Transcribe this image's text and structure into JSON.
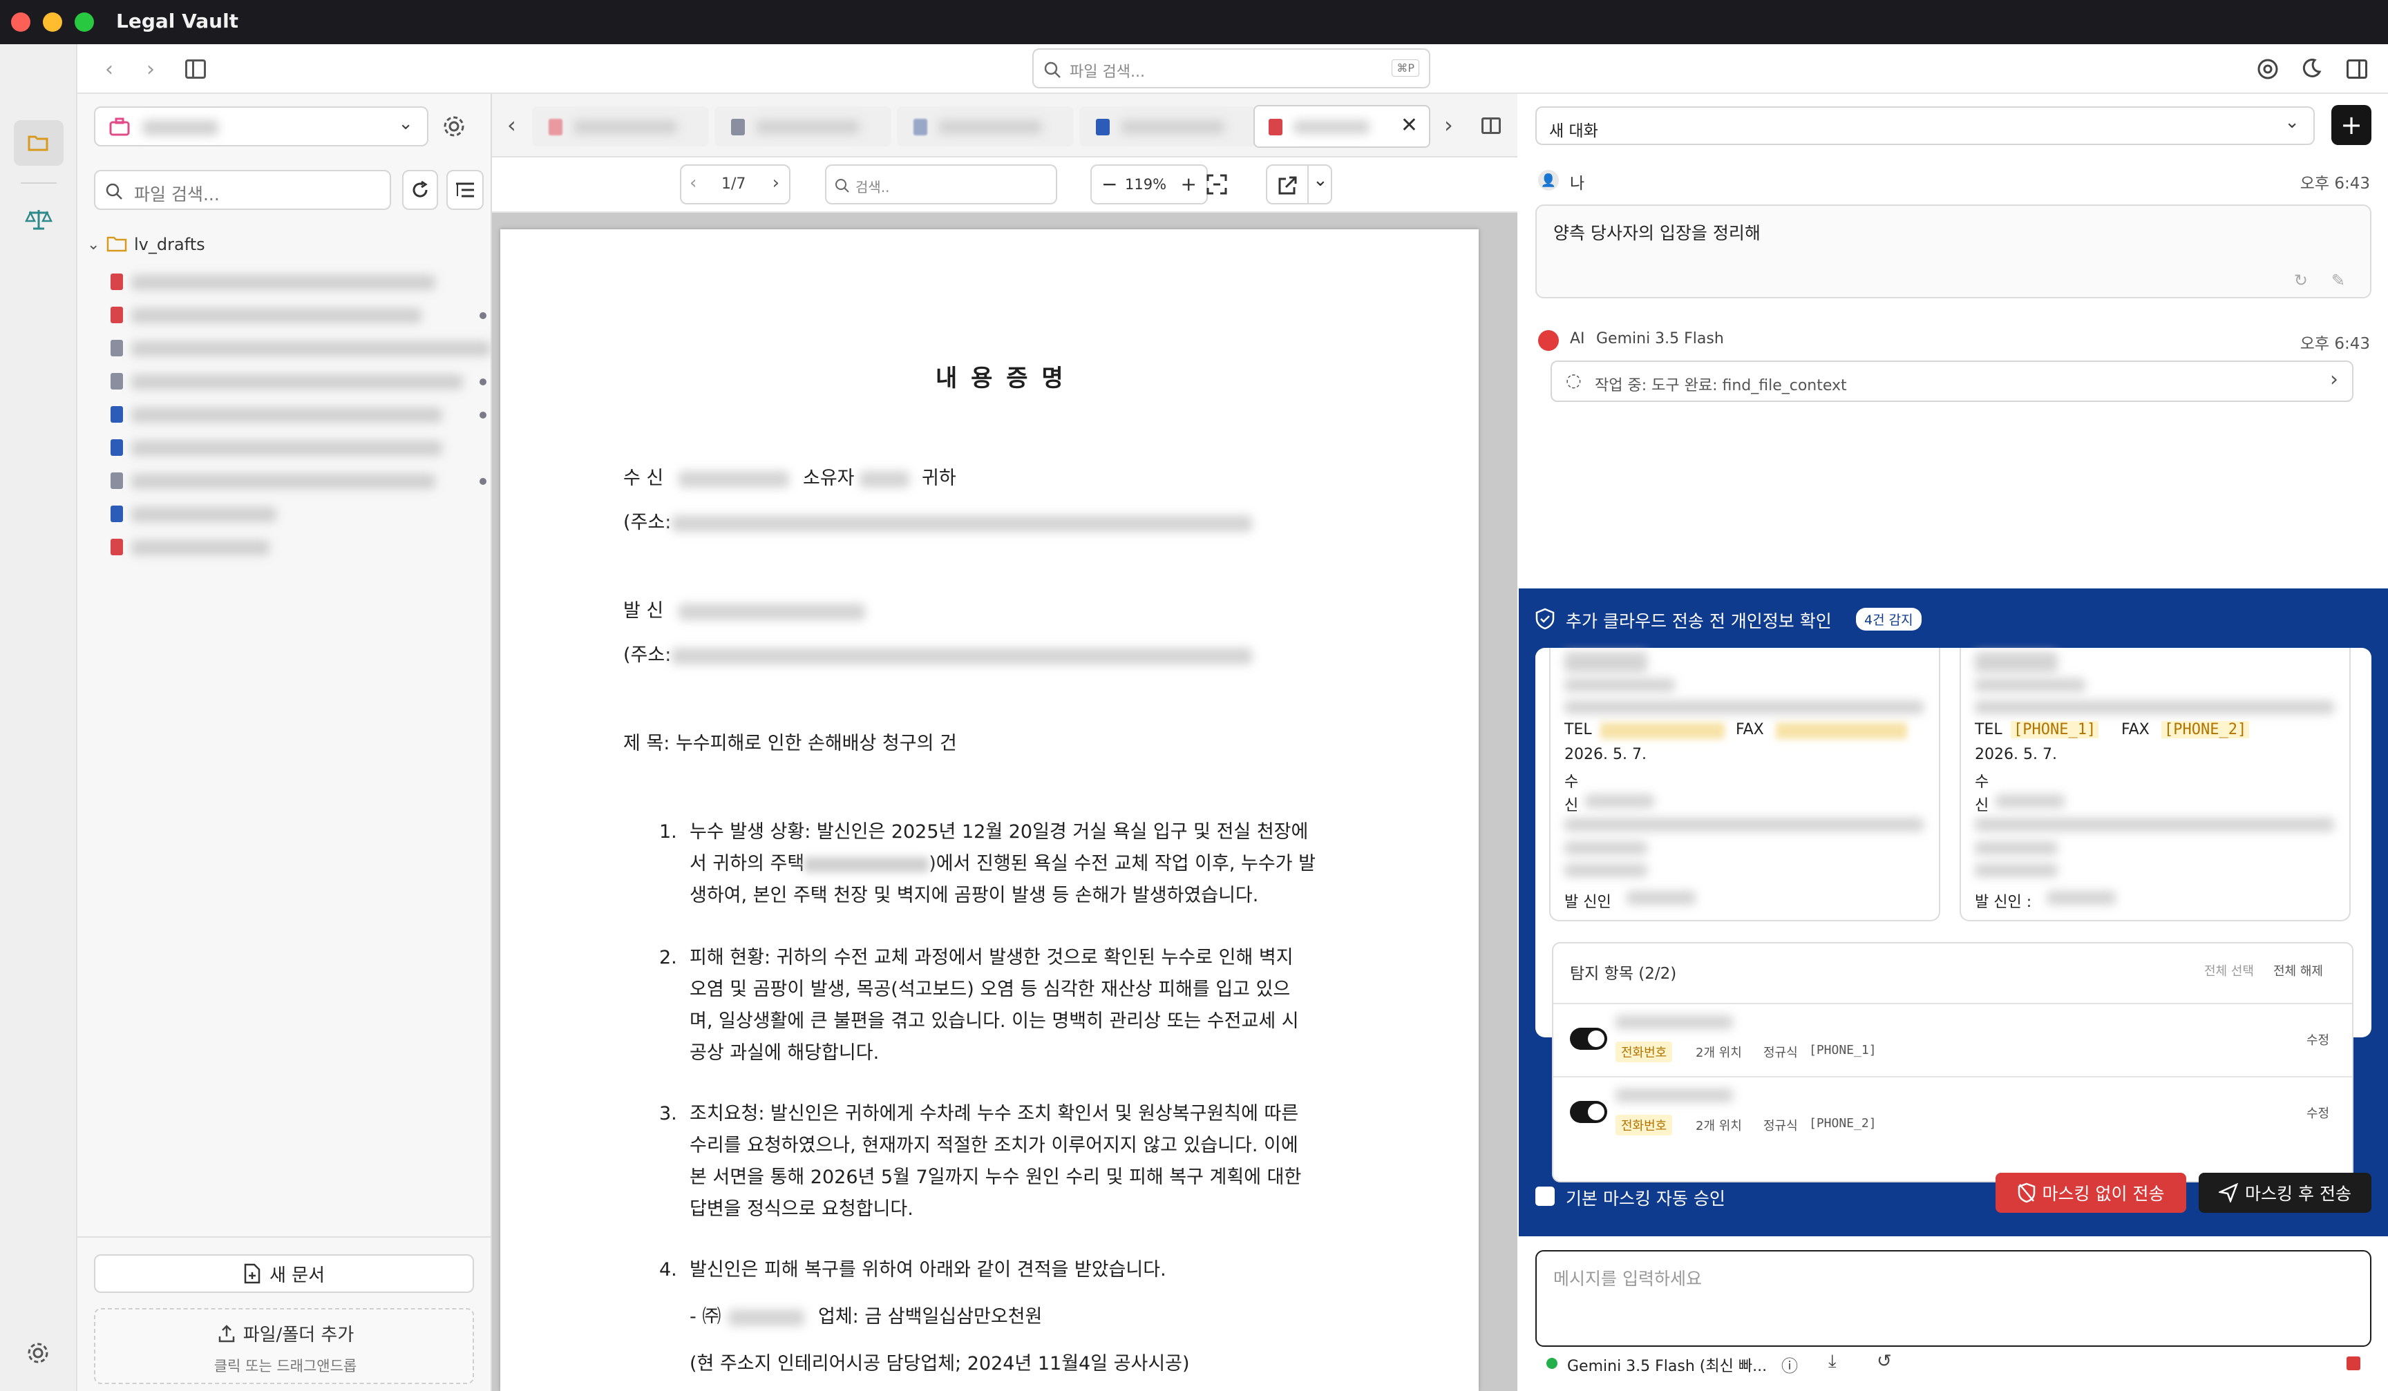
{
  "app": {
    "title": "Legal Vault"
  },
  "toolbar": {
    "search_placeholder": "파일 검색...",
    "search_shortcut": "⌘P"
  },
  "sidebar": {
    "search_placeholder": "파일 검색...",
    "folder_name": "lv_drafts",
    "new_doc_label": "새 문서",
    "add_files_label": "파일/폴더 추가",
    "add_files_hint": "클릭 또는 드래그앤드롭"
  },
  "viewer": {
    "page_indicator": "1/7",
    "search_placeholder": "검색..",
    "zoom": "119%",
    "doc": {
      "title": "내 용 증 명",
      "to_label": "수 신",
      "to_owner": "소유자",
      "to_suffix": "귀하",
      "address_label": "(주소:",
      "from_label": "발 신",
      "subject": "제 목: 누수피해로 인한 손해배상 청구의 건",
      "items": [
        {
          "num": "1.",
          "lines": [
            "누수 발생 상황: 발신인은 2025년 12월 20일경 거실 욕실 입구 및 전실 천장에",
            "서 귀하의 주택",
            ")에서 진행된 욕실 수전 교체 작업 이후, 누수가 발",
            "생하여, 본인 주택 천장 및 벽지에 곰팡이 발생 등 손해가 발생하였습니다."
          ]
        },
        {
          "num": "2.",
          "lines": [
            "피해 현황: 귀하의 수전 교체 과정에서 발생한 것으로 확인된 누수로 인해 벽지",
            "오염 및 곰팡이 발생, 목공(석고보드) 오염 등 심각한 재산상 피해를 입고 있으",
            "며, 일상생활에 큰 불편을 겪고 있습니다. 이는 명백히 관리상 또는 수전교세 시",
            "공상 과실에 해당합니다."
          ]
        },
        {
          "num": "3.",
          "lines": [
            "조치요청: 발신인은 귀하에게 수차례 누수 조치 확인서 및 원상복구원칙에 따른",
            "수리를 요청하였으나, 현재까지 적절한 조치가 이루어지지 않고 있습니다. 이에",
            "본 서면을 통해 2026년 5월 7일까지 누수 원인 수리 및 피해 복구 계획에 대한",
            "답변을 정식으로 요청합니다."
          ]
        },
        {
          "num": "4.",
          "lines": [
            "발신인은 피해 복구를 위하여 아래와 같이 견적을 받았습니다."
          ]
        }
      ],
      "estimate_line_prefix": "- ㈜",
      "estimate_line": "업체: 금 삼백일십삼만오천원",
      "estimate_note": "(현 주소지 인테리어시공 담당업체; 2024년 11월4일 공사시공)"
    }
  },
  "chat": {
    "conversation_select": "새 대화",
    "user": {
      "name": "나",
      "time": "오후 6:43",
      "message": "양측 당사자의 입장을 정리해"
    },
    "ai": {
      "badge": "AI",
      "model": "Gemini 3.5 Flash",
      "time": "오후 6:43",
      "status": "작업 중: 도구 완료: find_file_context"
    },
    "privacy": {
      "title": "추가 클라우드 전송 전 개인정보 확인",
      "badge": "4건 감지",
      "left_card": {
        "tel_label": "TEL",
        "fax_label": "FAX",
        "date": "2026. 5. 7.",
        "su": "수",
        "sin": "신",
        "sender_label": "발 신인"
      },
      "right_card": {
        "tel_label": "TEL",
        "tel_token": "[PHONE_1]",
        "fax_label": "FAX",
        "fax_token": "[PHONE_2]",
        "date": "2026. 5. 7.",
        "su": "수",
        "sin": "신",
        "sender_label": "발 신인 :"
      },
      "detected_title": "탐지 항목 (2/2)",
      "select_all": "전체 선택",
      "deselect_all": "전체 해제",
      "items": [
        {
          "tag": "전화번호",
          "count": "2개 위치",
          "method": "정규식",
          "token": "[PHONE_1]",
          "edit": "수정"
        },
        {
          "tag": "전화번호",
          "count": "2개 위치",
          "method": "정규식",
          "token": "[PHONE_2]",
          "edit": "수정"
        }
      ],
      "auto_approve_label": "기본 마스킹 자동 승인",
      "send_unmasked": "마스킹 없이 전송",
      "send_masked": "마스킹 후 전송"
    },
    "input_placeholder": "메시지를 입력하세요",
    "model_select": "Gemini 3.5 Flash (최신 빠..."
  },
  "colors": {
    "accent_blue": "#0f3b8f",
    "danger_red": "#d93a3a",
    "dark_button": "#1c1c1c",
    "pdf_red": "#d9434a",
    "doc_blue": "#2d5bb8"
  }
}
